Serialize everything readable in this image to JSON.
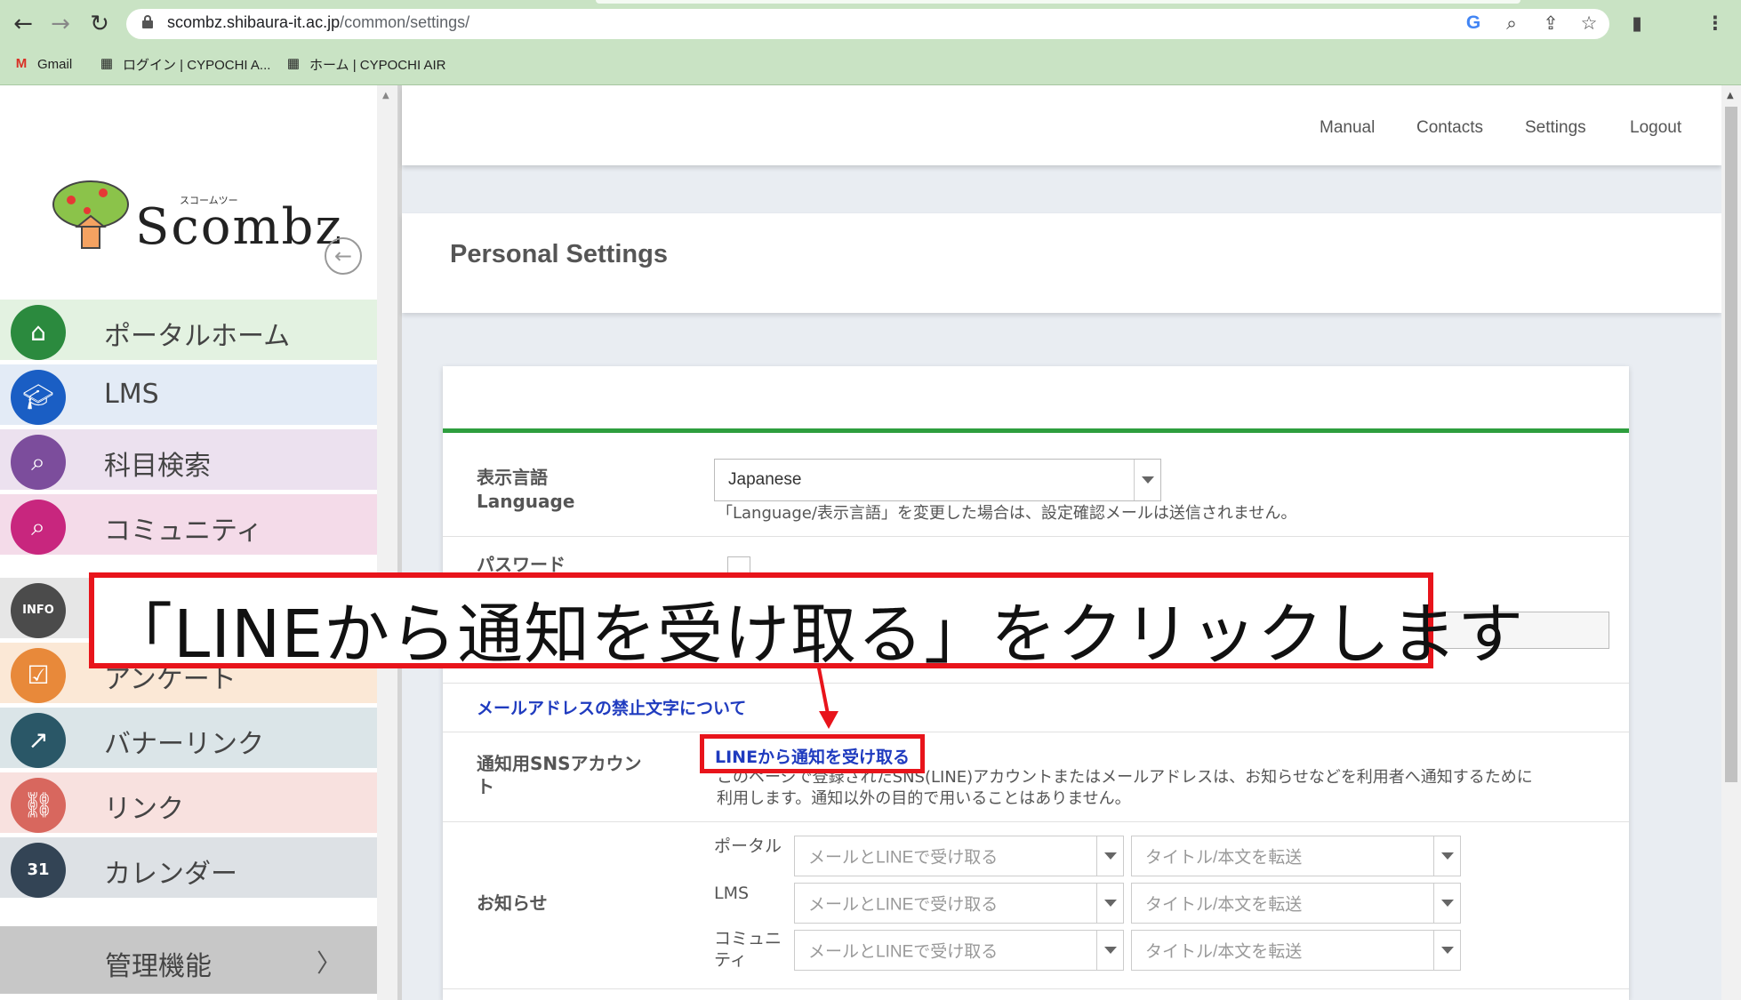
{
  "browser": {
    "back": "←",
    "forward": "→",
    "reload": "↻",
    "url_host": "scombz.shibaura-it.ac.jp",
    "url_path": "/common/settings/",
    "omnibox_icons": [
      "G",
      "⌕",
      "⇪",
      "☆"
    ],
    "sidepanel_icon": "▮",
    "menu_icon": "⋮",
    "bookmarks": [
      {
        "label": "Gmail",
        "icon": "gmail-icon",
        "glyph": "M"
      },
      {
        "label": "ログイン | CYPOCHI A...",
        "icon": "cypochi-icon",
        "glyph": "▦"
      },
      {
        "label": "ホーム | CYPOCHI AIR",
        "icon": "cypochi-icon",
        "glyph": "▦"
      }
    ]
  },
  "sidebar": {
    "logo_word": "Scombz",
    "logo_kana": "スコームツー",
    "back_glyph": "←",
    "items": [
      {
        "label": "ポータルホーム",
        "icon": "home-icon",
        "glyph": "⌂",
        "color": "#2b8a3e",
        "bg": "#e3f2e1"
      },
      {
        "label": "LMS",
        "icon": "graduation-cap-icon",
        "glyph": "🎓︎",
        "color": "#1a5ec4",
        "bg": "#e3ebf6"
      },
      {
        "label": "科目検索",
        "icon": "search-icon",
        "glyph": "⌕",
        "color": "#7c4d9c",
        "bg": "#ece1ef"
      },
      {
        "label": "コミュニティ",
        "icon": "community-search-icon",
        "glyph": "⌕",
        "color": "#c8267e",
        "bg": "#f4dbe9"
      },
      {
        "label": "",
        "icon": "info-icon",
        "glyph": "INFO",
        "color": "#4b4b4b",
        "bg": "#e6e6e6"
      },
      {
        "label": "アンケート",
        "icon": "survey-icon",
        "glyph": "☑",
        "color": "#e8893a",
        "bg": "#fbe8d6"
      },
      {
        "label": "バナーリンク",
        "icon": "banner-link-icon",
        "glyph": "↗",
        "color": "#2a5767",
        "bg": "#dbe5e8"
      },
      {
        "label": "リンク",
        "icon": "link-icon",
        "glyph": "⛓",
        "color": "#d8675e",
        "bg": "#f8e1df"
      },
      {
        "label": "カレンダー",
        "icon": "calendar-icon",
        "glyph": "31",
        "color": "#334455",
        "bg": "#dde1e5"
      }
    ],
    "admin_label": "管理機能",
    "admin_chevron": "〉"
  },
  "header": {
    "links": [
      "Manual",
      "Contacts",
      "Settings",
      "Logout"
    ]
  },
  "page_title": "Personal Settings",
  "form": {
    "language_label_ja": "表示言語",
    "language_label_en": "Language",
    "language_value": "Japanese",
    "language_hint": "「Language/表示言語」を変更した場合は、設定確認メールは送信されません。",
    "password_label": "パスワード",
    "email_note_link": "メールアドレスの禁止文字について",
    "sns_label": "通知用SNSアカウント",
    "sns_link": "LINEから通知を受け取る",
    "sns_hint_line1": "このページで登録されたSNS(LINE)アカウントまたはメールアドレスは、お知らせなどを利用者へ通知するために",
    "sns_hint_line2": "利用します。通知以外の目的で用いることはありません。",
    "notice_label": "お知らせ",
    "notice_rows": [
      {
        "label": "ポータル",
        "method": "メールとLINEで受け取る",
        "content": "タイトル/本文を転送"
      },
      {
        "label": "LMS",
        "method": "メールとLINEで受け取る",
        "content": "タイトル/本文を転送"
      },
      {
        "label": "コミュニティ",
        "method": "メールとLINEで受け取る",
        "content": "タイトル/本文を転送"
      }
    ]
  },
  "annotation": {
    "callout": "「LINEから通知を受け取る」をクリックします",
    "accent": "#e8141b"
  }
}
